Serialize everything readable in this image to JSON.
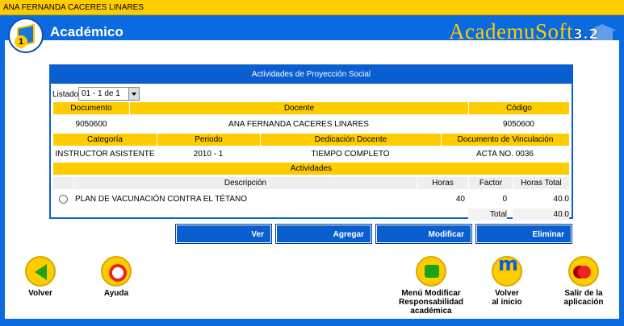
{
  "user_bar": {
    "name": "ANA FERNANDA CACERES LINARES"
  },
  "app": {
    "title": "Académico",
    "brand": "AcademuSoft",
    "version": "3.2"
  },
  "panel": {
    "title": "Actividades de Proyección Social",
    "listado_label": "Listado",
    "listado_value": "01 - 1 de 1",
    "headers1": {
      "documento": "Documento",
      "docente": "Docente",
      "codigo": "Código"
    },
    "row1": {
      "documento": "9050600",
      "docente": "ANA FERNANDA CACERES LINARES",
      "codigo": "9050600"
    },
    "headers2": {
      "categoria": "Categoría",
      "periodo": "Periodo",
      "dedicacion": "Dedicación Docente",
      "vinculacion": "Documento de Vinculación"
    },
    "row2": {
      "categoria": "INSTRUCTOR ASISTENTE",
      "periodo": "2010 - 1",
      "dedicacion": "TIEMPO COMPLETO",
      "vinculacion": "ACTA NO. 0036"
    },
    "actividades_title": "Actividades",
    "act_headers": {
      "descripcion": "Descripción",
      "horas": "Horas",
      "factor": "Factor",
      "horas_total": "Horas Total"
    },
    "activities": [
      {
        "descripcion": "PLAN DE VACUNACIÓN CONTRA EL TÉTANO",
        "horas": "40",
        "factor": "0",
        "horas_total": "40.0"
      }
    ],
    "total_label": "Total",
    "total_value": "40.0"
  },
  "buttons": {
    "ver": "Ver",
    "agregar": "Agregar",
    "modificar": "Modificar",
    "eliminar": "Eliminar"
  },
  "nav": {
    "volver": "Volver",
    "ayuda": "Ayuda",
    "menu_line1": "Menú Modificar",
    "menu_line2": "Responsabilidad",
    "menu_line3": "académica",
    "inicio_line1": "Volver",
    "inicio_line2": "al inicio",
    "salir_line1": "Salir de la",
    "salir_line2": "aplicación"
  },
  "colors": {
    "accent_blue": "#0a5fd0",
    "header_yellow": "#ffcc00",
    "row_gray": "#eeeeee"
  }
}
